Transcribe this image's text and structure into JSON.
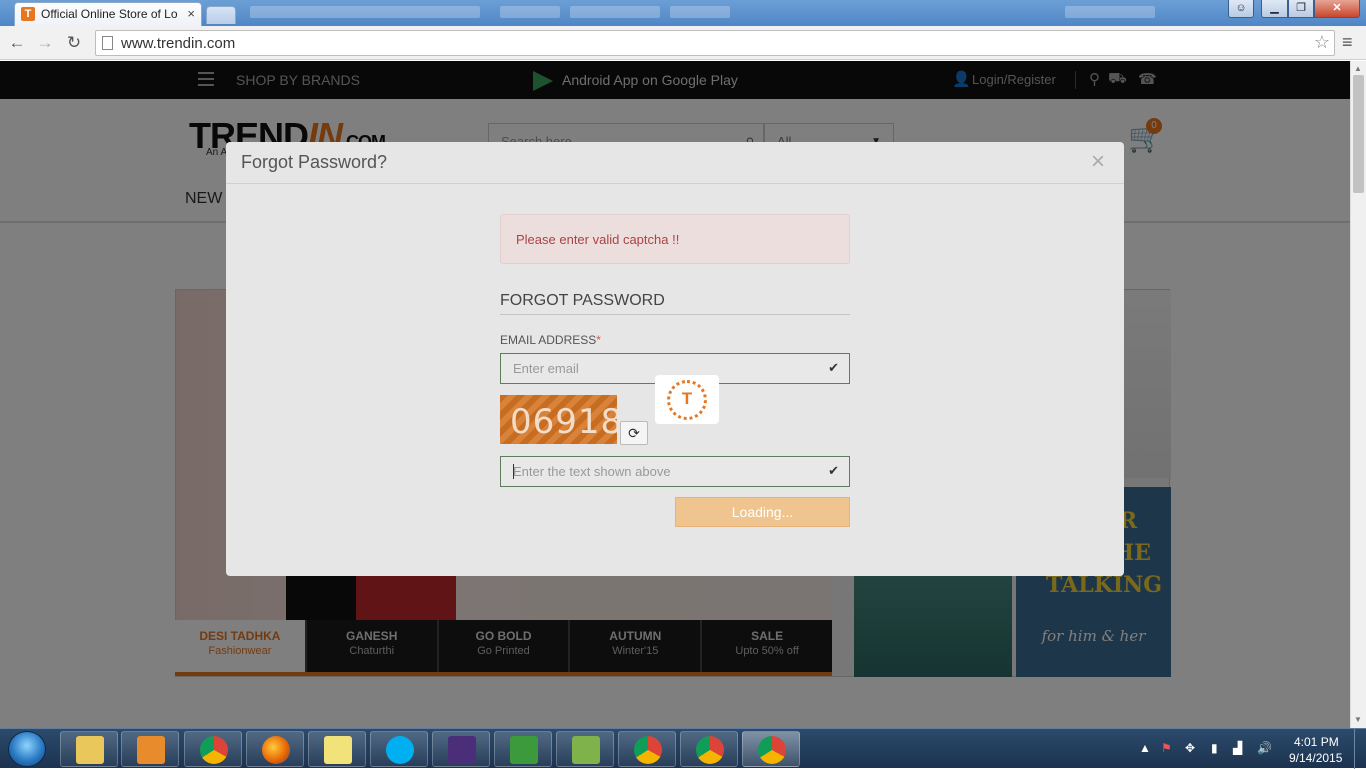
{
  "browser": {
    "tab_title": "Official Online Store of Lo",
    "tab_close": "×",
    "favicon_letter": "T",
    "url": "www.trendin.com",
    "window_buttons": {
      "minimize": "▁",
      "maximize": "❐",
      "close": "✕"
    }
  },
  "site": {
    "topbar": {
      "shop_by_brands": "SHOP BY BRANDS",
      "android_app": "Android App on Google Play",
      "login": "Login/Register"
    },
    "logo": "TREND",
    "logo_accent": "IN",
    "logo_suffix": ".COM",
    "logo_tagline": "An A",
    "search_placeholder": "Search here",
    "category_select": "All",
    "cart_count": "0",
    "nav_first": "NEW",
    "banner": {
      "talking": "YOUR DO THE TALKING",
      "talking_sub": "for him & her"
    },
    "category_tabs": [
      {
        "title": "DESI TADHKA",
        "subtitle": "Fashionwear",
        "active": true
      },
      {
        "title": "GANESH",
        "subtitle": "Chaturthi",
        "active": false
      },
      {
        "title": "GO BOLD",
        "subtitle": "Go Printed",
        "active": false
      },
      {
        "title": "AUTUMN",
        "subtitle": "Winter'15",
        "active": false
      },
      {
        "title": "SALE",
        "subtitle": "Upto 50% off",
        "active": false
      }
    ]
  },
  "modal": {
    "title": "Forgot Password?",
    "close": "×",
    "alert": "Please enter valid captcha !!",
    "heading": "FORGOT PASSWORD",
    "email_label": "EMAIL ADDRESS",
    "required_mark": "*",
    "email_placeholder": "Enter email",
    "captcha_value": "06918",
    "captcha_placeholder": "Enter the text shown above",
    "submit_label": "Loading...",
    "loader_letter": "T"
  },
  "taskbar": {
    "time": "4:01 PM",
    "date": "9/14/2015"
  },
  "colors": {
    "accent": "#e8761f",
    "alert_text": "#a94442",
    "titlebar": "#4f86c6"
  }
}
